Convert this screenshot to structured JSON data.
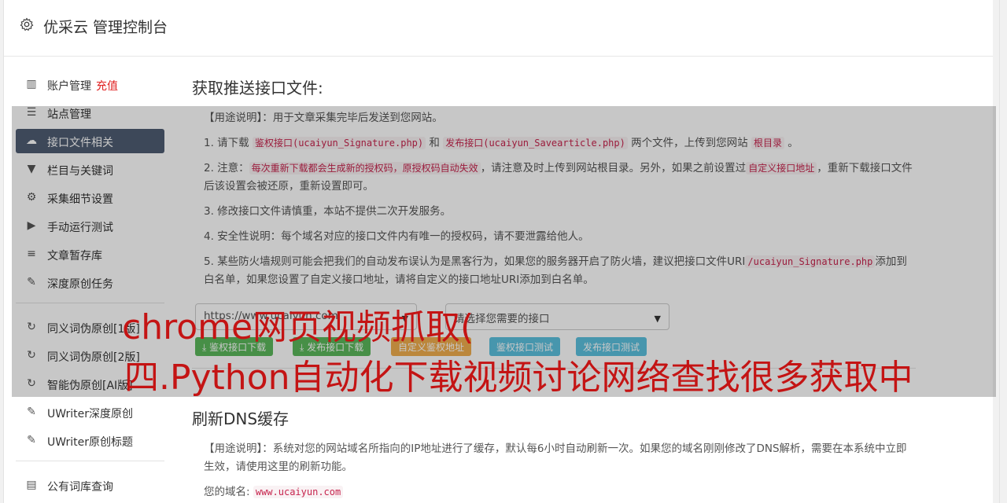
{
  "header": {
    "title": "优采云 管理控制台",
    "icon": "gear-icon"
  },
  "sidebar": {
    "items": [
      {
        "label": "账户管理",
        "extra": "充值",
        "icon": "bar-chart-icon",
        "glyph": "▥"
      },
      {
        "label": "站点管理",
        "icon": "server-icon",
        "glyph": "☰"
      },
      {
        "label": "接口文件相关",
        "icon": "cloud-upload-icon",
        "glyph": "☁",
        "active": true
      },
      {
        "label": "栏目与关键词",
        "icon": "filter-icon",
        "glyph": "▼"
      },
      {
        "label": "采集细节设置",
        "icon": "cogs-icon",
        "glyph": "⚙"
      },
      {
        "label": "手动运行测试",
        "icon": "play-circle-icon",
        "glyph": "▶"
      },
      {
        "label": "文章暂存库",
        "icon": "database-icon",
        "glyph": "≡"
      },
      {
        "label": "深度原创任务",
        "icon": "edit-icon",
        "glyph": "✎"
      },
      {
        "label": "同义词伪原创[1版]",
        "icon": "refresh-icon",
        "glyph": "↻"
      },
      {
        "label": "同义词伪原创[2版]",
        "icon": "refresh-icon",
        "glyph": "↻"
      },
      {
        "label": "智能伪原创[AI版]",
        "icon": "refresh-icon",
        "glyph": "↻"
      },
      {
        "label": "UWriter深度原创",
        "icon": "edit-icon",
        "glyph": "✎"
      },
      {
        "label": "UWriter原创标题",
        "icon": "edit-icon",
        "glyph": "✎"
      },
      {
        "label": "公有词库查询",
        "icon": "book-icon",
        "glyph": "▤"
      }
    ]
  },
  "section1": {
    "title": "获取推送接口文件:",
    "usage": "【用途说明】：用于文章采集完毕后发送到您网站。",
    "p1_a": "1. 请下载 ",
    "p1_code1": "鉴权接口(ucaiyun_Signature.php)",
    "p1_b": " 和 ",
    "p1_code2": "发布接口(ucaiyun_Savearticle.php)",
    "p1_c": " 两个文件，上传到您网站 ",
    "p1_code3": "根目录",
    "p1_d": " 。",
    "p2_a": "2. 注意：",
    "p2_code1": "每次重新下载都会生成新的授权码，原授权码自动失效",
    "p2_b": "，请注意及时上传到网站根目录。另外，如果之前设置过",
    "p2_code2": "自定义接口地址",
    "p2_c": "，重新下载接口文件后该设置会被还原，重新设置即可。",
    "p3": "3. 修改接口文件请慎重，本站不提供二次开发服务。",
    "p4": "4. 安全性说明：每个域名对应的接口文件内有唯一的授权码，请不要泄露给他人。",
    "p5_a": "5. 某些防火墙规则可能会把我们的自动发布误认为是黑客行为，如果您的服务器开启了防火墙，建议把接口文件URI",
    "p5_code": "/ucaiyun_Signature.php",
    "p5_b": "添加到白名单，如果您设置了自定义接口地址，请将自定义的接口地址URI添加到白名单。",
    "site_select": "https://www.ucaiyun.com",
    "api_select": "请选择您需要的接口",
    "buttons": {
      "sign_download": "鉴权接口下载",
      "publish_download": "发布接口下载",
      "custom_sign": "自定义鉴权地址",
      "sign_test": "鉴权接口测试",
      "publish_test": "发布接口测试"
    }
  },
  "section2": {
    "title": "刷新DNS缓存",
    "usage": "【用途说明】：系统对您的网站域名所指向的IP地址进行了缓存，默认每6小时自动刷新一次。如果您的域名刚刚修改了DNS解析，需要在本系统中立即生效，请使用这里的刷新功能。",
    "domain_label": "您的域名:",
    "domain_value": "www.ucaiyun.com"
  },
  "watermark": {
    "line1": "chrome网页视频抓取(",
    "line2": "四.Python自动化下载视频讨论网络查找很多获取中"
  },
  "colors": {
    "active_sidebar": "#4f5d73",
    "watermark": "#c41414",
    "recharge": "#e02020"
  }
}
